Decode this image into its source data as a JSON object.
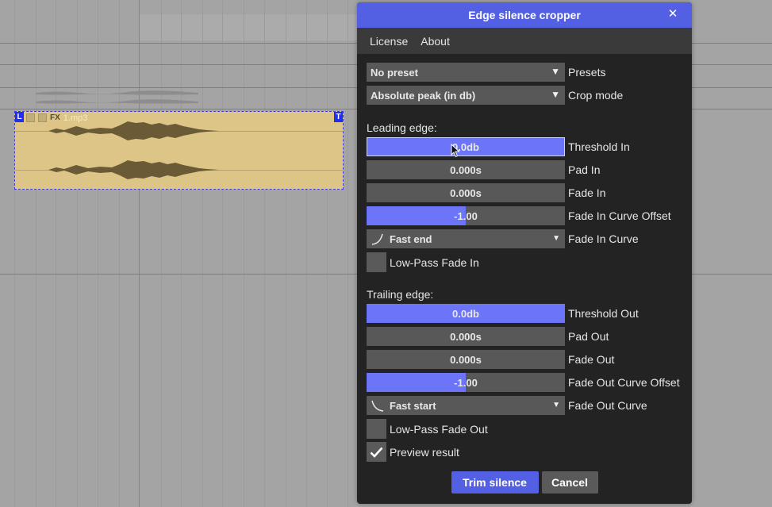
{
  "item": {
    "left_tag": "L",
    "right_tag": "T",
    "fx_label": "FX",
    "filename": "1.mp3"
  },
  "dialog": {
    "title": "Edge silence cropper",
    "close_glyph": "✕",
    "menu": [
      "License",
      "About"
    ],
    "presets": {
      "value": "No preset",
      "label": "Presets"
    },
    "crop_mode": {
      "value": "Absolute peak (in db)",
      "label": "Crop mode"
    },
    "leading": {
      "heading": "Leading edge:",
      "threshold": {
        "value": "0.0db",
        "label": "Threshold In",
        "fill": 1.0
      },
      "pad": {
        "value": "0.000s",
        "label": "Pad In",
        "fill": 0
      },
      "fade": {
        "value": "0.000s",
        "label": "Fade In",
        "fill": 0
      },
      "curve_offset": {
        "value": "-1.00",
        "label": "Fade In Curve Offset",
        "fill": 0.5
      },
      "curve": {
        "value": "Fast end",
        "label": "Fade In Curve",
        "icon": "fast-end-curve-icon"
      },
      "lowpass": {
        "label": "Low-Pass Fade In",
        "checked": false
      }
    },
    "trailing": {
      "heading": "Trailing edge:",
      "threshold": {
        "value": "0.0db",
        "label": "Threshold Out",
        "fill": 1.0
      },
      "pad": {
        "value": "0.000s",
        "label": "Pad Out",
        "fill": 0
      },
      "fade": {
        "value": "0.000s",
        "label": "Fade Out",
        "fill": 0
      },
      "curve_offset": {
        "value": "-1.00",
        "label": "Fade Out Curve Offset",
        "fill": 0.5
      },
      "curve": {
        "value": "Fast start",
        "label": "Fade Out Curve",
        "icon": "fast-start-curve-icon"
      },
      "lowpass": {
        "label": "Low-Pass Fade Out",
        "checked": false
      }
    },
    "preview": {
      "label": "Preview result",
      "checked": true
    },
    "buttons": {
      "trim": "Trim silence",
      "cancel": "Cancel"
    }
  },
  "colors": {
    "accent": "#5460e4",
    "slider_fill": "#6c74f8",
    "control_bg": "#585858",
    "dialog_bg": "#232323",
    "item_bg": "#dcc587"
  }
}
